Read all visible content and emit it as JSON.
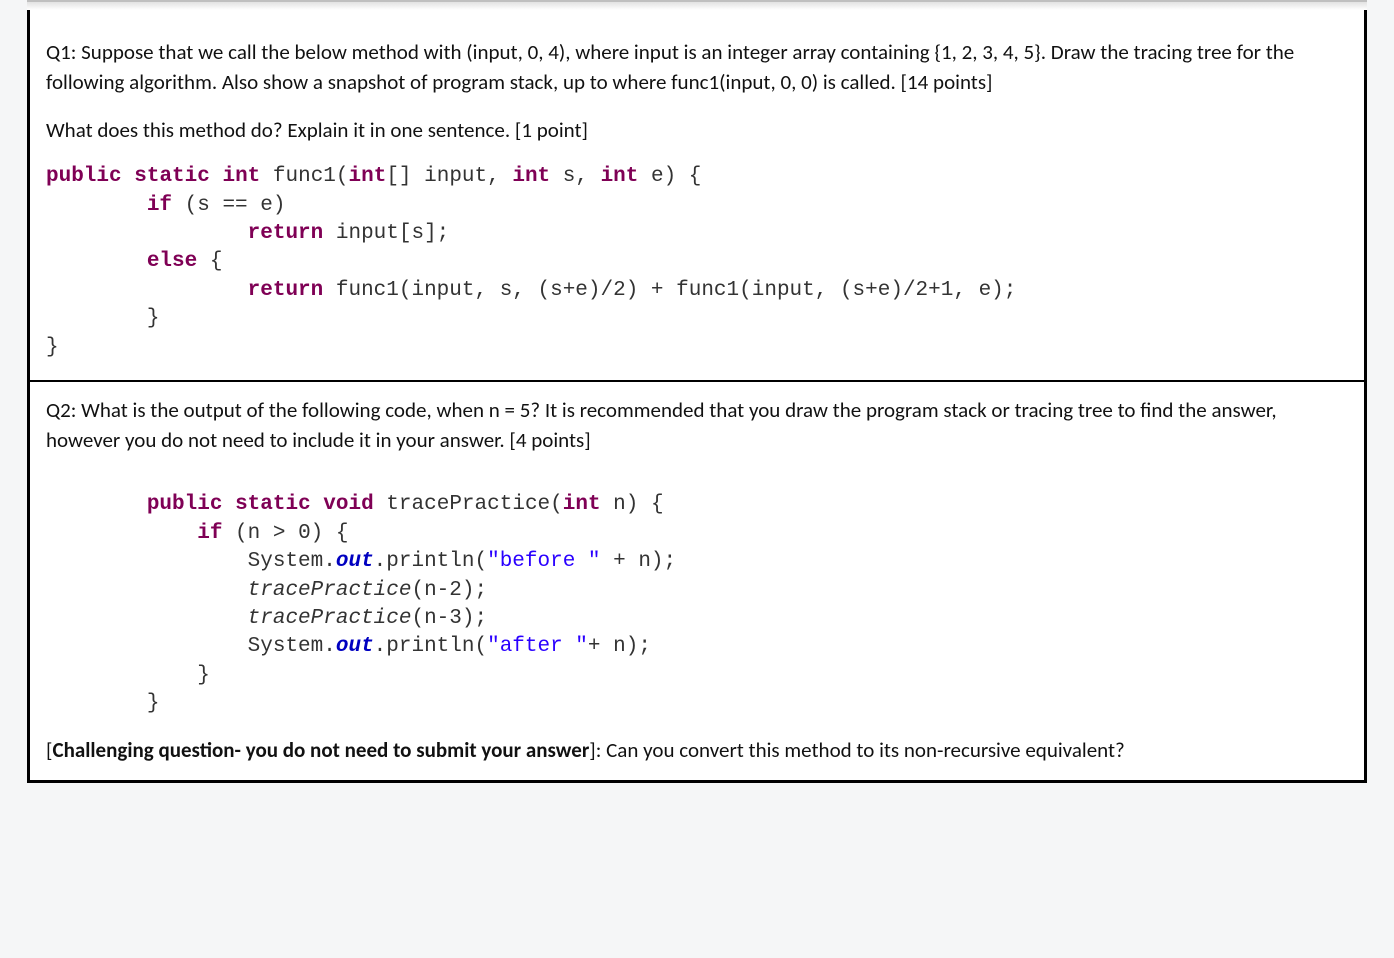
{
  "q1": {
    "para1": "Q1: Suppose that we call the below method with (input, 0, 4), where input is an integer array containing {1, 2, 3, 4, 5}. Draw the tracing tree for the following algorithm. Also show a snapshot of program stack, up to where func1(input, 0, 0) is called. [14 points]",
    "para2": "What does this method do? Explain it in one sentence. [1 point]",
    "code": {
      "l1a": "public",
      "l1b": " ",
      "l1c": "static",
      "l1d": " ",
      "l1e": "int",
      "l1f": " func1(",
      "l1g": "int",
      "l1h": "[] input, ",
      "l1i": "int",
      "l1j": " s, ",
      "l1k": "int",
      "l1l": " e) {",
      "l2a": "        ",
      "l2b": "if",
      "l2c": " (s == e)",
      "l3a": "                ",
      "l3b": "return",
      "l3c": " input[s];",
      "l4a": "        ",
      "l4b": "else",
      "l4c": " {",
      "l5a": "                ",
      "l5b": "return",
      "l5c": " func1(input, s, (s+e)/2) + func1(input, (s+e)/2+1, e);",
      "l6": "        }",
      "l7": "}"
    }
  },
  "q2": {
    "para1": "Q2:  What is the output of the following code, when n = 5? It is recommended that you draw the program stack or tracing tree to find the answer, however you do not need to include it in your answer. [4 points]",
    "code": {
      "l1a": "        ",
      "l1b": "public",
      "l1c": " ",
      "l1d": "static",
      "l1e": " ",
      "l1f": "void",
      "l1g": " tracePractice(",
      "l1h": "int",
      "l1i": " n) {",
      "l2a": "            ",
      "l2b": "if",
      "l2c": " (n > 0) {",
      "l3a": "                System.",
      "l3b": "out",
      "l3c": ".println(",
      "l3d": "\"before \"",
      "l3e": " + n);",
      "l4a": "                ",
      "l4b": "tracePractice",
      "l4c": "(n-2);",
      "l5a": "                ",
      "l5b": "tracePractice",
      "l5c": "(n-3);",
      "l6a": "                System.",
      "l6b": "out",
      "l6c": ".println(",
      "l6d": "\"after \"",
      "l6e": "+ n);",
      "l7": "            }",
      "l8": "        }"
    },
    "challenge_prefix": "Challenging question- you do not need to submit your answer",
    "challenge_rest": "]: Can you convert this method to its non-recursive equivalent?"
  }
}
